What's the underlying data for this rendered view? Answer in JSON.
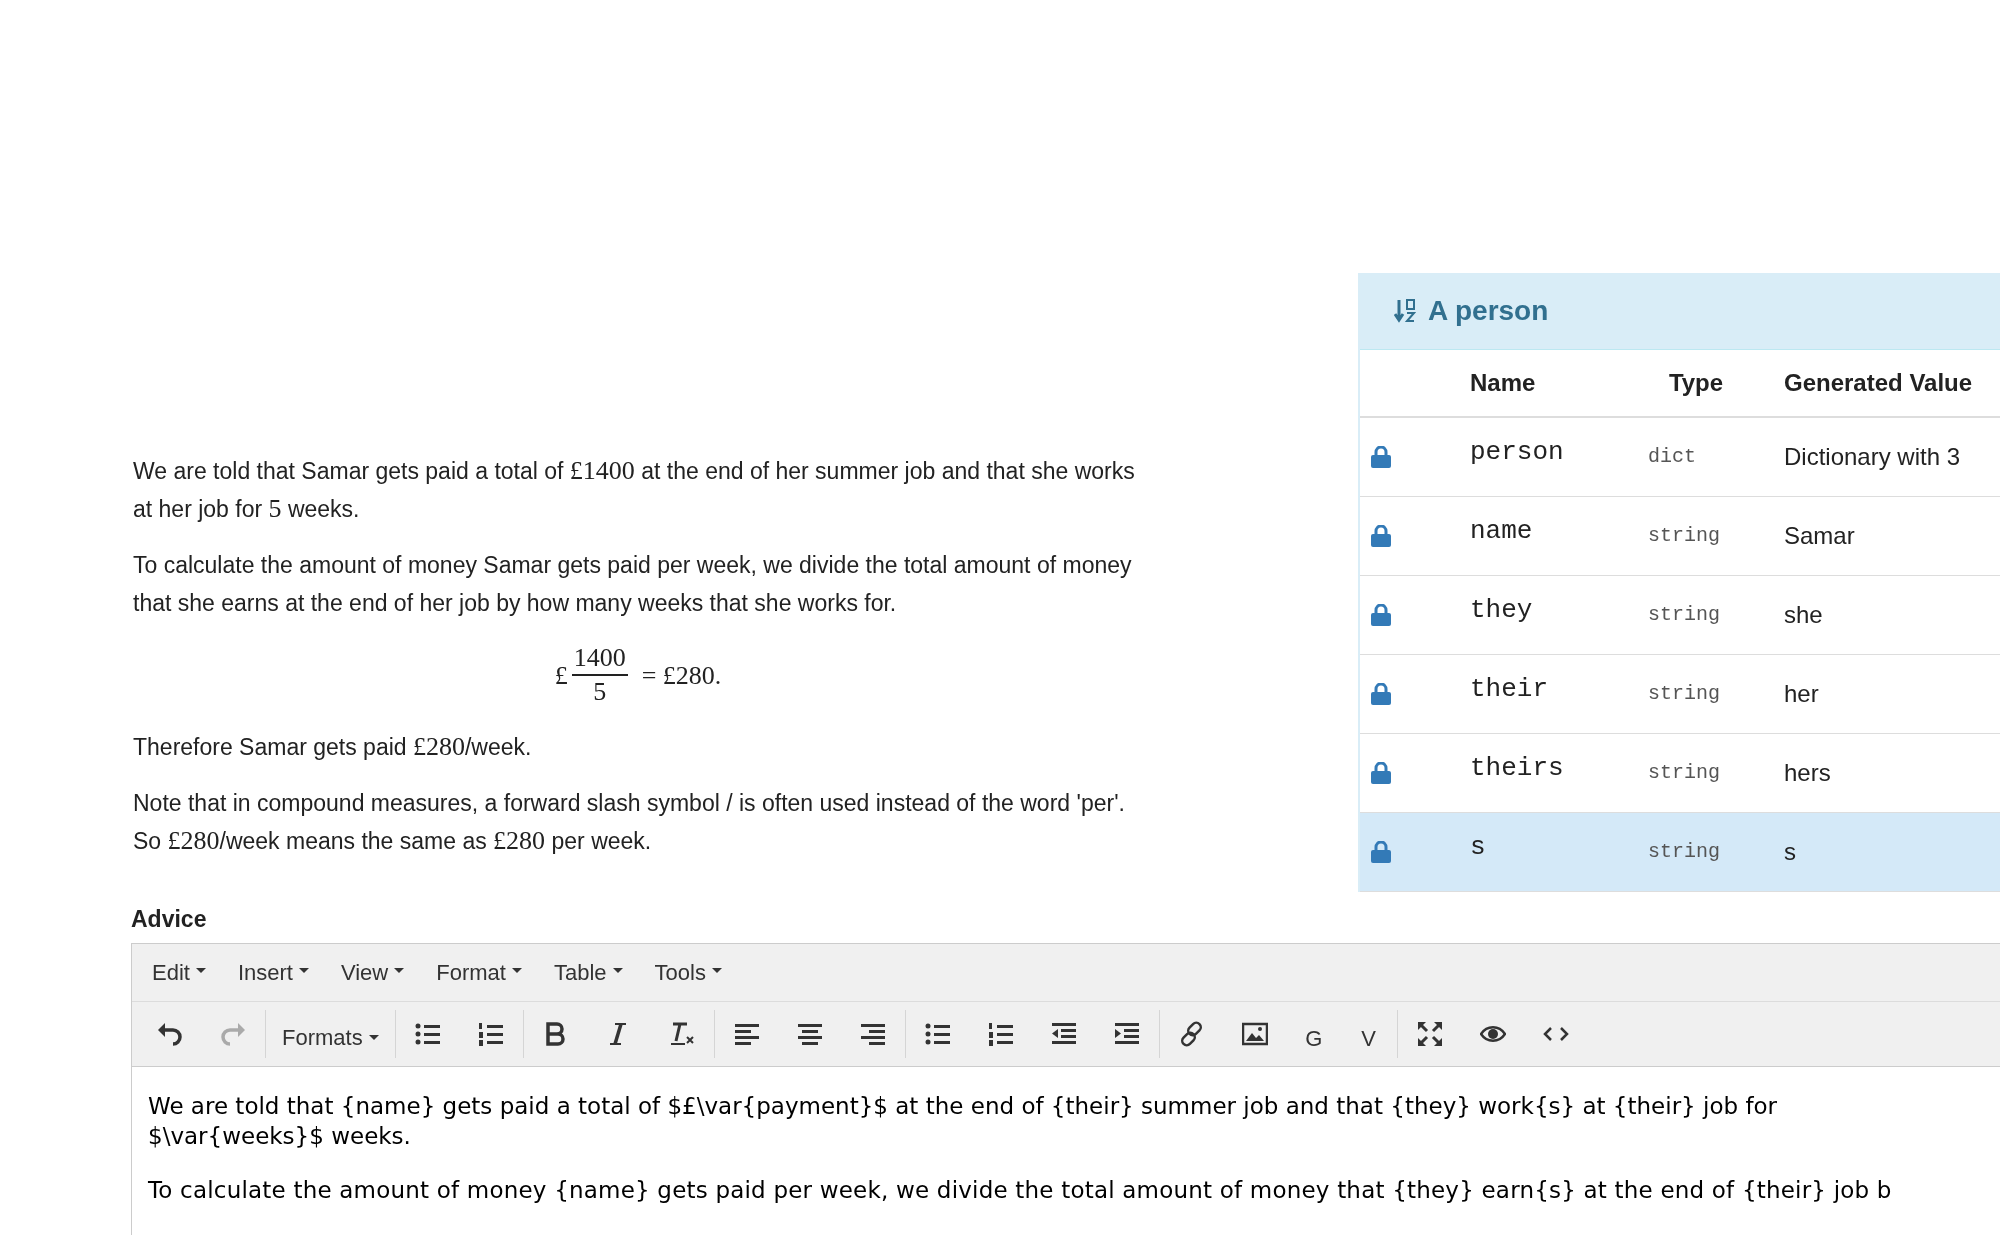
{
  "solution": {
    "paragraphs": [
      [
        {
          "kind": "text",
          "text": "We are told that Samar gets paid a total of "
        },
        {
          "kind": "math",
          "text": "£1400"
        },
        {
          "kind": "text",
          "text": " at the end of her summer job and that she works at her job for "
        },
        {
          "kind": "math",
          "text": "5"
        },
        {
          "kind": "text",
          "text": " weeks."
        }
      ],
      [
        {
          "kind": "text",
          "text": "To calculate the amount of money Samar gets paid per week, we divide the total amount of money that she earns at the end of her job by how many weeks that she works for."
        }
      ],
      [
        {
          "kind": "fraction",
          "prefix": "£",
          "numerator": "1400",
          "denominator": "5",
          "rest": "= £280."
        }
      ],
      [
        {
          "kind": "text",
          "text": "Therefore Samar gets paid "
        },
        {
          "kind": "math",
          "text": "£280"
        },
        {
          "kind": "text",
          "text": "/week."
        }
      ],
      [
        {
          "kind": "text",
          "text": "Note that in compound measures, a forward slash symbol / is often used instead of the word 'per'. So "
        },
        {
          "kind": "math",
          "text": "£280"
        },
        {
          "kind": "text",
          "text": "/week means the same as "
        },
        {
          "kind": "math",
          "text": "£280"
        },
        {
          "kind": "text",
          "text": " per week."
        }
      ]
    ]
  },
  "variables_panel": {
    "title": "A person",
    "columns": [
      "Name",
      "Type",
      "Generated Value"
    ],
    "rows": [
      {
        "name": "person",
        "type": "dict",
        "value": "Dictionary with 3",
        "selected": false
      },
      {
        "name": "name",
        "type": "string",
        "value": "Samar",
        "selected": false
      },
      {
        "name": "they",
        "type": "string",
        "value": "she",
        "selected": false
      },
      {
        "name": "their",
        "type": "string",
        "value": "her",
        "selected": false
      },
      {
        "name": "theirs",
        "type": "string",
        "value": "hers",
        "selected": false
      },
      {
        "name": "s",
        "type": "string",
        "value": "s",
        "selected": true
      }
    ]
  },
  "advice": {
    "label": "Advice",
    "menu": [
      "Edit",
      "Insert",
      "View",
      "Format",
      "Table",
      "Tools"
    ],
    "toolbar": {
      "undo_disabled": false,
      "redo_disabled": true,
      "formats": "Formats",
      "letters": [
        "G",
        "V"
      ]
    },
    "content": [
      "We are told that {name} gets paid a total of $£\\var{payment}$ at the end of {their} summer job and that {they} work{s} at {their} job for $\\var{weeks}$ weeks.",
      "To calculate the amount of money {name} gets paid per week, we divide the total amount of money that {they} earn{s} at the end of {their} job b"
    ]
  }
}
